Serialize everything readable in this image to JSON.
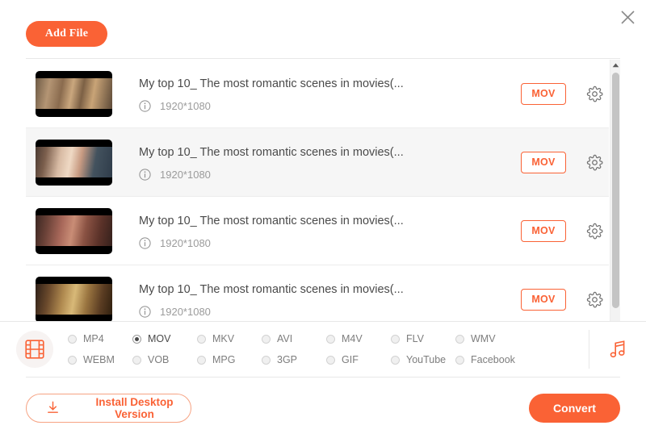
{
  "window": {
    "close_label": "×",
    "close_icon": "close-icon"
  },
  "toolbar": {
    "add_file_label": "Add File"
  },
  "colors": {
    "accent": "#FA6235",
    "accent_soft": "#F6A383",
    "row_alt": "#F6F6F6",
    "text_primary": "#4A4A4A",
    "text_muted": "#9B9B9B",
    "divider": "#E8E8E8"
  },
  "file_list": {
    "scrollbar": {
      "up_arrow_icon": "chevron-up-icon"
    },
    "rows": [
      {
        "title": "My top 10_ The most romantic scenes in movies(...",
        "resolution": "1920*1080",
        "format": "MOV",
        "info_icon": "info-icon",
        "settings_icon": "gear-icon",
        "highlighted": false
      },
      {
        "title": "My top 10_ The most romantic scenes in movies(...",
        "resolution": "1920*1080",
        "format": "MOV",
        "info_icon": "info-icon",
        "settings_icon": "gear-icon",
        "highlighted": true
      },
      {
        "title": "My top 10_ The most romantic scenes in movies(...",
        "resolution": "1920*1080",
        "format": "MOV",
        "info_icon": "info-icon",
        "settings_icon": "gear-icon",
        "highlighted": false
      },
      {
        "title": "My top 10_ The most romantic scenes in movies(...",
        "resolution": "1920*1080",
        "format": "MOV",
        "info_icon": "info-icon",
        "settings_icon": "gear-icon",
        "highlighted": false
      }
    ]
  },
  "format_bar": {
    "video_icon": "film-strip-icon",
    "audio_icon": "music-note-icon",
    "selected": "MOV",
    "options": [
      {
        "label": "MP4",
        "selected": false
      },
      {
        "label": "MOV",
        "selected": true
      },
      {
        "label": "MKV",
        "selected": false
      },
      {
        "label": "AVI",
        "selected": false
      },
      {
        "label": "M4V",
        "selected": false
      },
      {
        "label": "FLV",
        "selected": false
      },
      {
        "label": "WMV",
        "selected": false
      },
      {
        "label": "WEBM",
        "selected": false
      },
      {
        "label": "VOB",
        "selected": false
      },
      {
        "label": "MPG",
        "selected": false
      },
      {
        "label": "3GP",
        "selected": false
      },
      {
        "label": "GIF",
        "selected": false
      },
      {
        "label": "YouTube",
        "selected": false
      },
      {
        "label": "Facebook",
        "selected": false
      }
    ]
  },
  "footer": {
    "install_label": "Install Desktop Version",
    "install_icon": "download-icon",
    "convert_label": "Convert"
  }
}
